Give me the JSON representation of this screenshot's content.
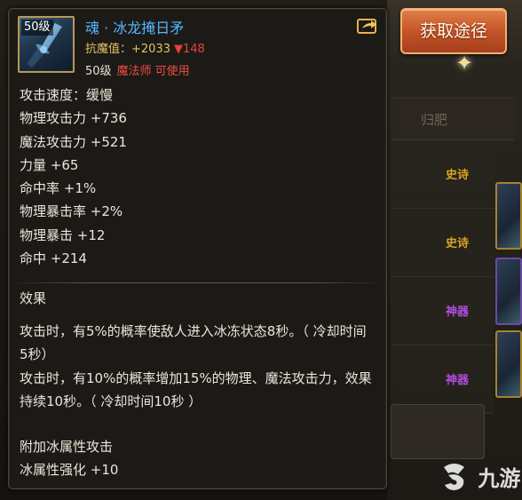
{
  "tooltip": {
    "level_badge": "50级",
    "item_name": "魂 · 冰龙掩日矛",
    "resist_label": "抗魔值：",
    "resist_value": "+2033",
    "resist_delta": "▼148",
    "req_level": "50级",
    "req_class": "魔法师 可使用",
    "stats": [
      "攻击速度：缓慢",
      "物理攻击力 +736",
      "魔法攻击力 +521",
      "力量 +65",
      "命中率 +1%",
      "物理暴击率 +2%",
      "物理暴击 +12",
      "命中 +214"
    ],
    "effect_title": "效果",
    "effect_lines": [
      "攻击时，有5%的概率使敌人进入冰冻状态8秒。（ 冷却时间5秒）",
      "攻击时，有10%的概率增加15%的物理、魔法攻击力，效果持续10秒。（ 冷却时间10秒 ）"
    ],
    "extra_lines": [
      "附加冰属性攻击",
      "冰属性强化 +10"
    ]
  },
  "path_button": {
    "label": "获取途径"
  },
  "background": {
    "header": "归肥",
    "tags": [
      {
        "text": "史诗",
        "color": "#d8a520"
      },
      {
        "text": "史诗",
        "color": "#d8a520"
      },
      {
        "text": "神器",
        "color": "#b24de0"
      },
      {
        "text": "神器",
        "color": "#b24de0"
      }
    ]
  },
  "watermark": {
    "text": "九游"
  },
  "colors": {
    "item_name": "#52b7ff",
    "resist": "#e1c363",
    "warning": "#e6413a",
    "button": "#c8582a"
  }
}
